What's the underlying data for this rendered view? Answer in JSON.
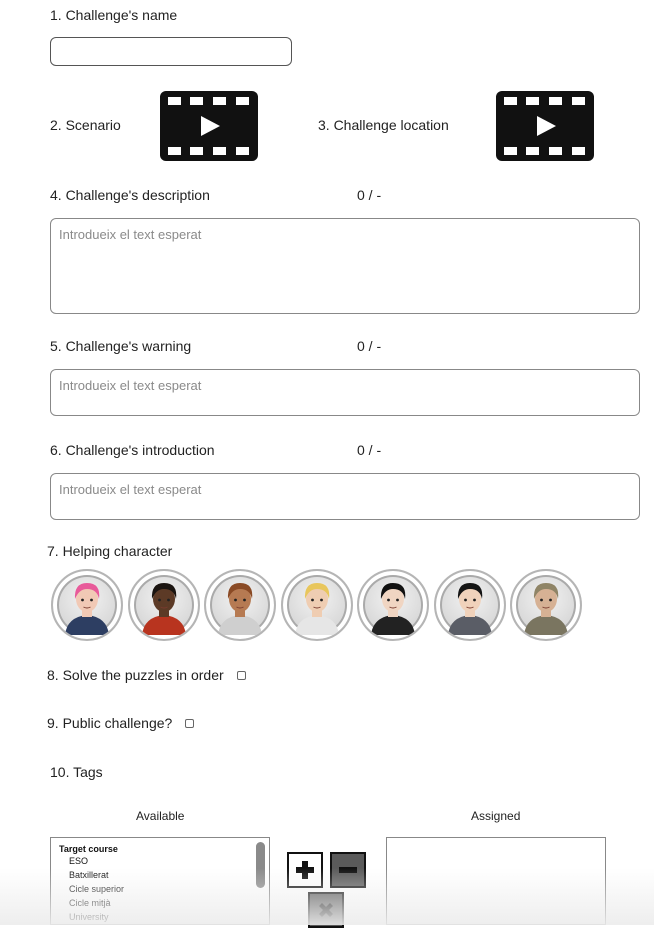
{
  "form": {
    "name": {
      "label": "1. Challenge's name",
      "value": ""
    },
    "scenario": {
      "label": "2. Scenario",
      "icon": "video-icon"
    },
    "location": {
      "label": "3. Challenge location",
      "icon": "video-icon"
    },
    "description": {
      "label": "4. Challenge's description",
      "counter": "0 / -",
      "placeholder": "Introdueix el text esperat"
    },
    "warning": {
      "label": "5. Challenge's warning",
      "counter": "0 / -",
      "placeholder": "Introdueix el text esperat"
    },
    "introduction": {
      "label": "6. Challenge's introduction",
      "counter": "0 / -",
      "placeholder": "Introdueix el text esperat"
    },
    "helping_character": {
      "label": "7. Helping character",
      "avatars": [
        {
          "name": "avatar-pink-hair",
          "hair": "#e85a9a",
          "skin": "#f1c9b5",
          "shirt": "#2d3e62"
        },
        {
          "name": "avatar-dark-skin",
          "hair": "#1a1410",
          "skin": "#5c3a26",
          "shirt": "#b8341f"
        },
        {
          "name": "avatar-curly-hair",
          "hair": "#8a4a25",
          "skin": "#b67a52",
          "shirt": "#cfcfcf"
        },
        {
          "name": "avatar-blond-hair",
          "hair": "#e8c65c",
          "skin": "#efcdb2",
          "shirt": "#e6e6e6"
        },
        {
          "name": "avatar-long-black-hair",
          "hair": "#111111",
          "skin": "#f0d5c2",
          "shirt": "#222222"
        },
        {
          "name": "avatar-short-black-hair",
          "hair": "#151515",
          "skin": "#f0d2bb",
          "shirt": "#5a5d66"
        },
        {
          "name": "avatar-hijab",
          "hair": "#8f8466",
          "skin": "#d6b194",
          "shirt": "#7a7560"
        }
      ]
    },
    "solve_in_order": {
      "label": "8. Solve the puzzles in order"
    },
    "public": {
      "label": "9. Public challenge?"
    },
    "tags": {
      "label": "10. Tags",
      "available_title": "Available",
      "assigned_title": "Assigned",
      "available": {
        "group": "Target course",
        "items": [
          "ESO",
          "Batxillerat",
          "Cicle superior",
          "Cicle mitjà",
          "University"
        ]
      },
      "add_icon": "plus-icon",
      "remove_icon": "minus-icon",
      "clear_icon": "times-icon"
    }
  },
  "colors": {
    "border": "#888888",
    "icon_dark": "#111111",
    "button_gray": "#5a5a5a"
  }
}
